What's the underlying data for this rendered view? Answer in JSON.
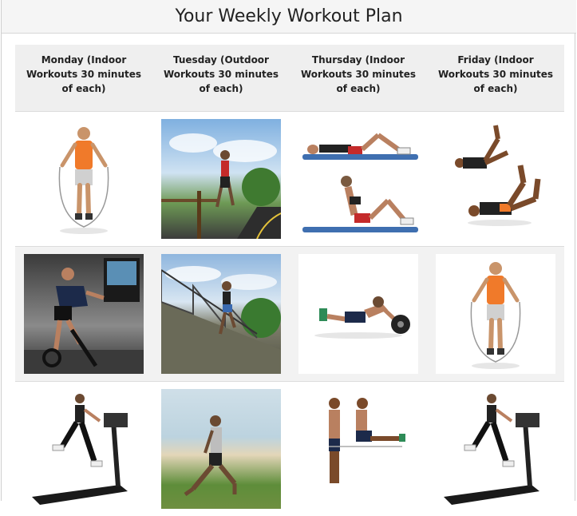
{
  "page": {
    "title": "Your Weekly Workout Plan"
  },
  "table": {
    "headers": [
      "Monday (Indoor Workouts 30 minutes of each)",
      "Tuesday (Outdoor Workouts 30 minutes of each)",
      "Thursday (Indoor Workouts 30 minutes of each)",
      "Friday (Indoor Workouts 30 minutes of each)"
    ],
    "rows": [
      [
        "jump-rope",
        "outdoor-run",
        "crunches",
        "bicycle-crunch"
      ],
      [
        "indoor-cycling",
        "stair-run",
        "ab-roller",
        "jump-rope"
      ],
      [
        "treadmill",
        "beach-lunge",
        "v-sit",
        "treadmill"
      ]
    ]
  },
  "colors": {
    "header_bg": "#f5f5f5",
    "th_bg": "#efefef",
    "alt_row_bg": "#f2f2f2"
  }
}
